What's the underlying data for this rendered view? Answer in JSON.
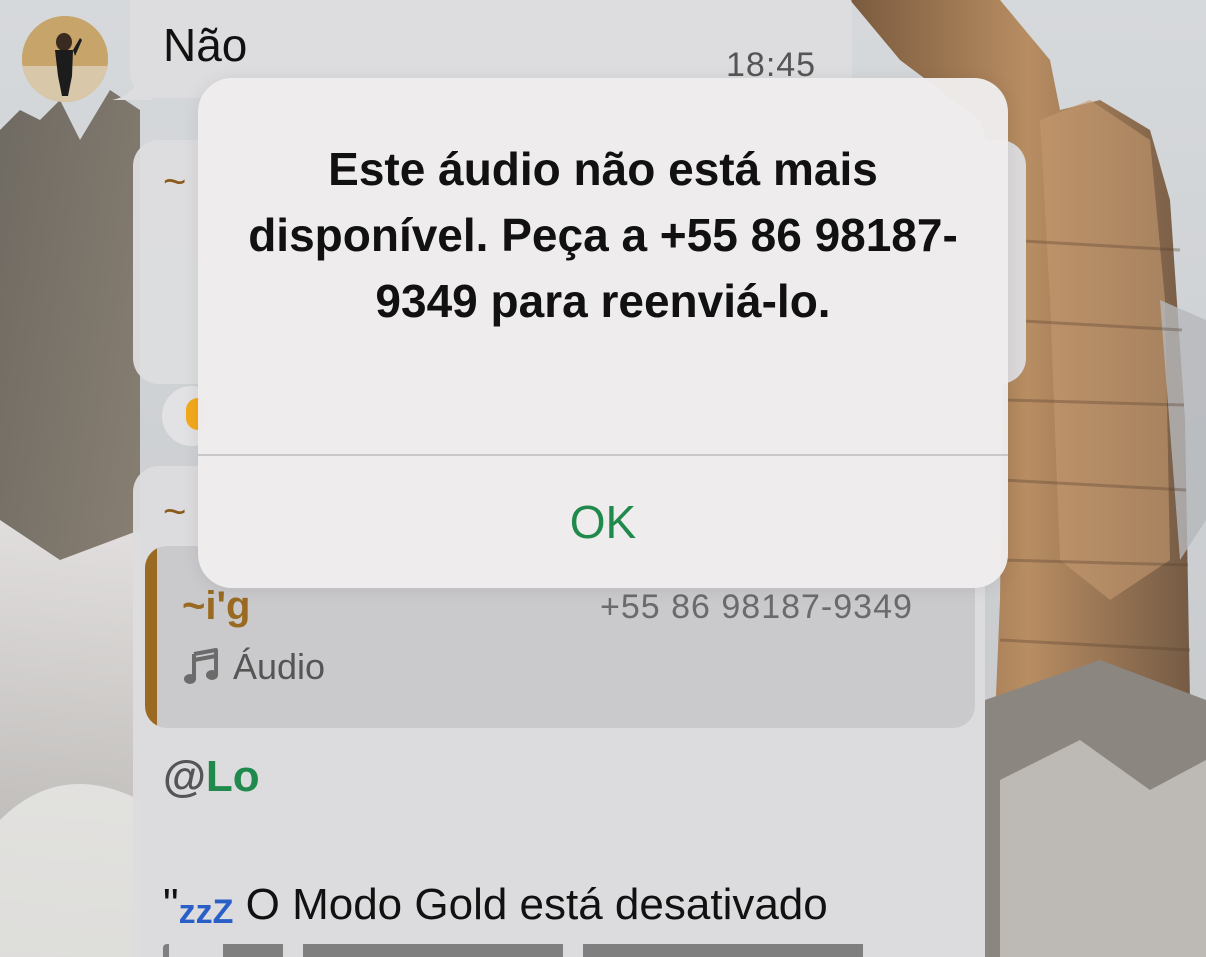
{
  "chat": {
    "message_nao": {
      "text": "Não",
      "time": "18:45"
    },
    "bubble_2": {
      "sender_prefix": "~"
    },
    "bubble_3": {
      "sender_prefix": "~",
      "quote": {
        "author": "~i'g",
        "phone": "+55 86 98187-9349",
        "media_icon": "music-note-icon",
        "media_label": "Áudio"
      },
      "mention_at": "@",
      "mention_name": "Lo",
      "gold_line_quote": "\"",
      "gold_line_zzz": "zzZ",
      "gold_line_text": " O Modo Gold está desativado"
    }
  },
  "alert": {
    "message": "Este áudio não está mais disponível. Peça a +55 86 98187-9349 para reenviá-lo.",
    "ok_label": "OK"
  },
  "colors": {
    "alert_ok": "#1f8a4c",
    "mention": "#1f8a4c",
    "quote_author": "#9a6a22",
    "zzz": "#2a5fc8"
  }
}
